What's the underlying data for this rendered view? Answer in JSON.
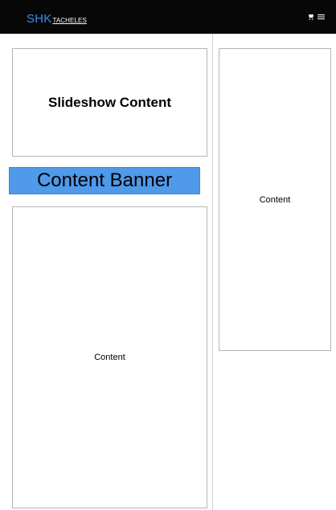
{
  "header": {
    "logo_primary": "SHK",
    "logo_secondary": "TACHELES",
    "icons": [
      "cart-icon",
      "menu-icon"
    ],
    "colors": {
      "background": "#070707",
      "logo_primary": "#3d8ee8",
      "logo_secondary": "#ffffff"
    }
  },
  "main": {
    "slideshow_label": "Slideshow Content",
    "banner_label": "Content Banner",
    "banner_color": "#4f9ae9",
    "content_label": "Content"
  },
  "sidebar": {
    "content_label": "Content"
  }
}
